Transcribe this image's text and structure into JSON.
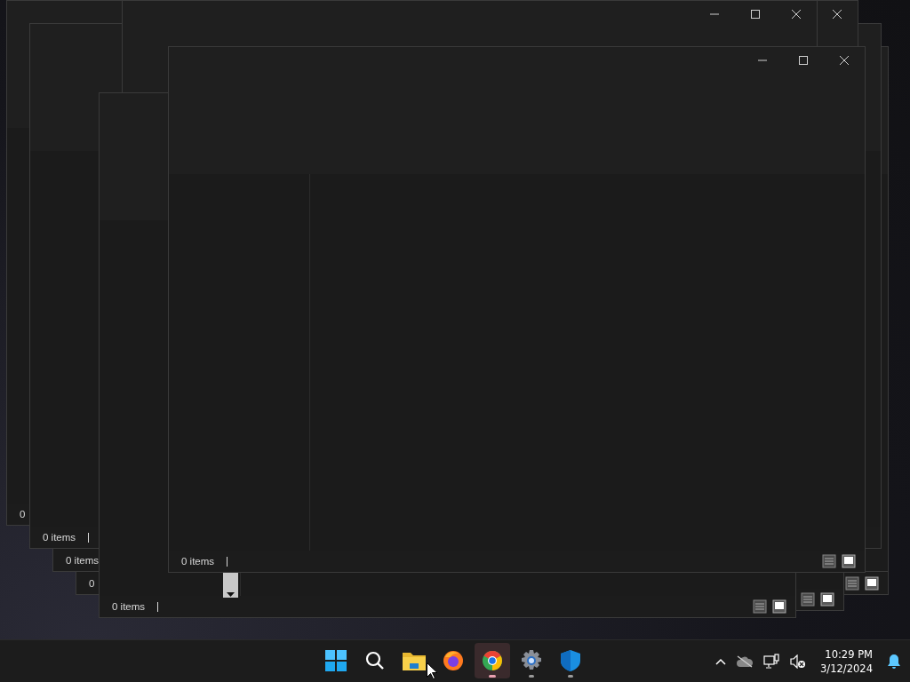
{
  "windows": [
    {
      "controls": [
        {
          "kind": "minimize"
        },
        {
          "kind": "maximize"
        },
        {
          "kind": "close"
        }
      ],
      "status": "0 items",
      "views": [
        {
          "kind": "details",
          "selected": false
        },
        {
          "kind": "tiles",
          "selected": true
        }
      ]
    },
    {
      "status": "0 items",
      "views": [
        {
          "kind": "details",
          "selected": false
        },
        {
          "kind": "tiles",
          "selected": true
        }
      ]
    },
    {
      "controls": [
        {
          "kind": "minimize"
        },
        {
          "kind": "maximize"
        },
        {
          "kind": "close"
        }
      ]
    },
    {
      "controls": [
        {
          "kind": "close"
        }
      ]
    },
    {
      "views": [
        {
          "kind": "details",
          "selected": false
        },
        {
          "kind": "tiles",
          "selected": true
        }
      ]
    },
    {
      "status": "0 items"
    },
    {
      "status": "0"
    },
    {
      "status": "0 items"
    },
    {
      "status": "0",
      "views": [
        {
          "kind": "details",
          "selected": false
        },
        {
          "kind": "tiles",
          "selected": true
        }
      ]
    }
  ],
  "taskbar": {
    "apps": [
      {
        "kind": "start",
        "selected": false,
        "running": false
      },
      {
        "kind": "search",
        "selected": false,
        "running": false
      },
      {
        "kind": "folder",
        "selected": false,
        "running": false
      },
      {
        "kind": "firefox",
        "selected": false,
        "running": false
      },
      {
        "kind": "chrome",
        "selected": true,
        "running": true
      },
      {
        "kind": "settings",
        "selected": false,
        "running": true
      },
      {
        "kind": "shield",
        "selected": false,
        "running": true
      }
    ],
    "time": "10:29 PM",
    "date": "3/12/2024"
  }
}
